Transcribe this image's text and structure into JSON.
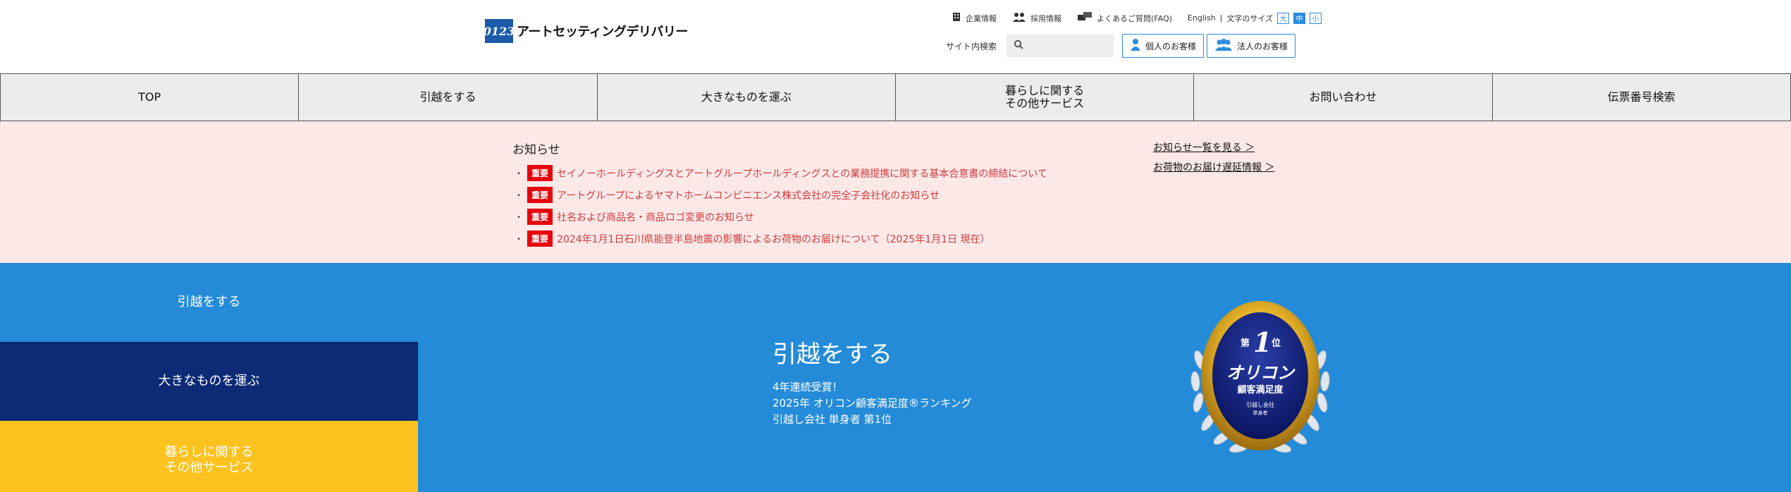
{
  "header": {
    "logo_mark": "0123",
    "logo_text": "アートセッティングデリバリー",
    "util": {
      "company": "企業情報",
      "recruit": "採用情報",
      "faq": "よくあるご質問(FAQ)",
      "english": "English",
      "separator": "|",
      "font_size_label": "文字のサイズ",
      "font_sizes": [
        "大",
        "中",
        "小"
      ]
    },
    "search": {
      "label": "サイト内検索",
      "placeholder": ""
    },
    "personal_button": "個人のお客様",
    "business_button": "法人のお客様",
    "icons": {
      "company": "building-icon",
      "recruit": "people-icon",
      "faq": "chat-bubble-icon",
      "search": "search-icon",
      "personal": "person-icon",
      "business": "group-icon"
    }
  },
  "nav": {
    "items": [
      "TOP",
      "引越をする",
      "大きなものを運ぶ",
      "暮らしに関する\nその他サービス",
      "お問い合わせ",
      "伝票番号検索"
    ]
  },
  "notice": {
    "title": "お知らせ",
    "badge": "重要",
    "bullet": "・",
    "items": [
      "セイノーホールディングスとアートグループホールディングスとの業務提携に関する基本合意書の締結について",
      "アートグループによるヤマトホームコンビニエンス株式会社の完全子会社化のお知らせ",
      "社名および商品名・商品ロゴ変更のお知らせ",
      "2024年1月1日石川県能登半島地震の影響によるお荷物のお届けについて（2025年1月1日 現在）"
    ],
    "links": [
      "お知らせ一覧を見る ＞",
      "お荷物のお届け遅延情報 ＞"
    ]
  },
  "hero": {
    "tabs": [
      "引越をする",
      "大きなものを運ぶ",
      "暮らしに関する\nその他サービス"
    ],
    "title": "引越をする",
    "desc": [
      "4年連続受賞！",
      "2025年 オリコン顧客満足度®ランキング",
      "引越し会社 単身者 第1位"
    ],
    "award": {
      "rank_prefix": "第",
      "rank_number": "1",
      "rank_suffix": "位",
      "brand": "オリコン",
      "subtitle": "顧客満足度",
      "category": "引越し会社",
      "subcategory": "単身者"
    }
  },
  "colors": {
    "brand_blue": "#1a5aa8",
    "accent_blue": "#2a8be0",
    "hero_blue": "#248bd9",
    "navy": "#0c2a75",
    "yellow": "#fcc21f",
    "notice_bg": "#fde8e8",
    "badge_red": "#e8000b",
    "notice_text": "#d03c3c"
  }
}
